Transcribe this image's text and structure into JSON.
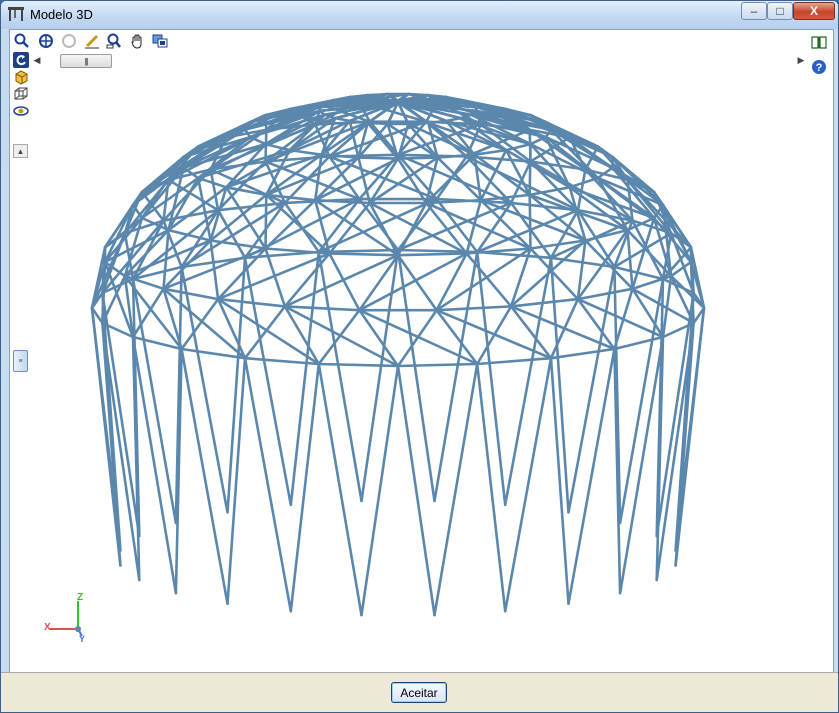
{
  "window": {
    "title": "Modelo 3D"
  },
  "controls": {
    "minimize": "–",
    "maximize": "□",
    "close": "X"
  },
  "toolbar": {
    "tools": [
      "zoom-rotate-icon",
      "zoom-fit-icon",
      "zoom-previous-icon",
      "pencil-measure-icon",
      "zoom-window-icon",
      "pan-hand-icon",
      "views-icon"
    ]
  },
  "left_tools": [
    "rotate-icon",
    "solid-view-icon",
    "wireframe-cube-icon",
    "eye-settings-icon"
  ],
  "right_tools": [
    "book-icon",
    "help-icon"
  ],
  "axes": {
    "z": "Z",
    "x": "X",
    "y": "Y"
  },
  "colors": {
    "structure": "#5b87ad",
    "axis_z": "#2ec52e",
    "axis_x": "#e05050",
    "axis_y": "#4a6fd6"
  },
  "footer": {
    "accept_label": "Aceitar"
  }
}
